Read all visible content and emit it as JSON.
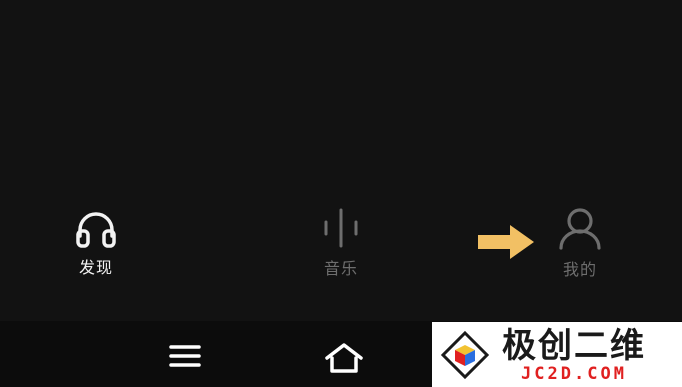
{
  "tabs": [
    {
      "label": "发现",
      "icon": "headphones-icon",
      "active": true
    },
    {
      "label": "音乐",
      "icon": "waveform-icon",
      "active": false
    },
    {
      "label": "我的",
      "icon": "user-icon",
      "active": false
    }
  ],
  "nav": {
    "menu_icon": "menu-icon",
    "home_icon": "home-icon"
  },
  "watermark": {
    "cn": "极创二维",
    "en": "JC2D.COM"
  },
  "colors": {
    "active": "#f2f2f2",
    "inactive": "#6e6e6e",
    "arrow": "#f2c064",
    "watermark_red": "#e02020"
  }
}
